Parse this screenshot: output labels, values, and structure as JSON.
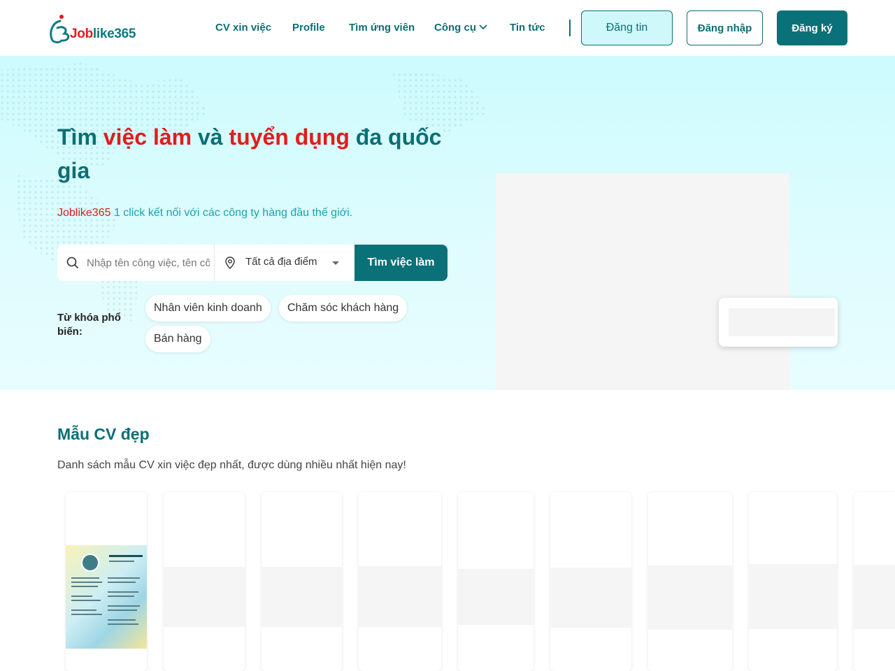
{
  "header": {
    "logo": {
      "brand_part1": "Job",
      "brand_part2": "like365"
    },
    "nav": [
      {
        "label": "CV xin việc"
      },
      {
        "label": "Profile"
      },
      {
        "label": "Tìm ứng viên"
      },
      {
        "label": "Công cụ"
      },
      {
        "label": "Tin tức"
      }
    ],
    "btn_post": "Đăng tin",
    "btn_login": "Đăng nhập",
    "btn_register": "Đăng ký"
  },
  "hero": {
    "title_1": "Tìm ",
    "title_2": "việc làm",
    "title_3": " và ",
    "title_4": "tuyển dụng",
    "title_5": " đa quốc gia",
    "sub_brand": "Joblike365",
    "sub_text": " 1 click kết nối với các công ty hàng đầu thế giới.",
    "search_placeholder": "Nhập tên công việc, tên công ty",
    "location": "Tất cả địa điểm",
    "search_button": "Tìm việc làm",
    "keywords_label": "Từ khóa phổ biến:",
    "keywords": [
      "Nhân viên kinh doanh",
      "Chăm sóc khách hàng",
      "Bán hàng"
    ]
  },
  "cv_section": {
    "title": "Mẫu CV đẹp",
    "subtitle": "Danh sách mẫu CV xin việc đẹp nhất, được dùng nhiều nhất hiện nay!"
  },
  "colors": {
    "brand_teal": "#0a7178",
    "brand_red": "#e21c1c",
    "hero_bg": "#cdfbfe"
  }
}
